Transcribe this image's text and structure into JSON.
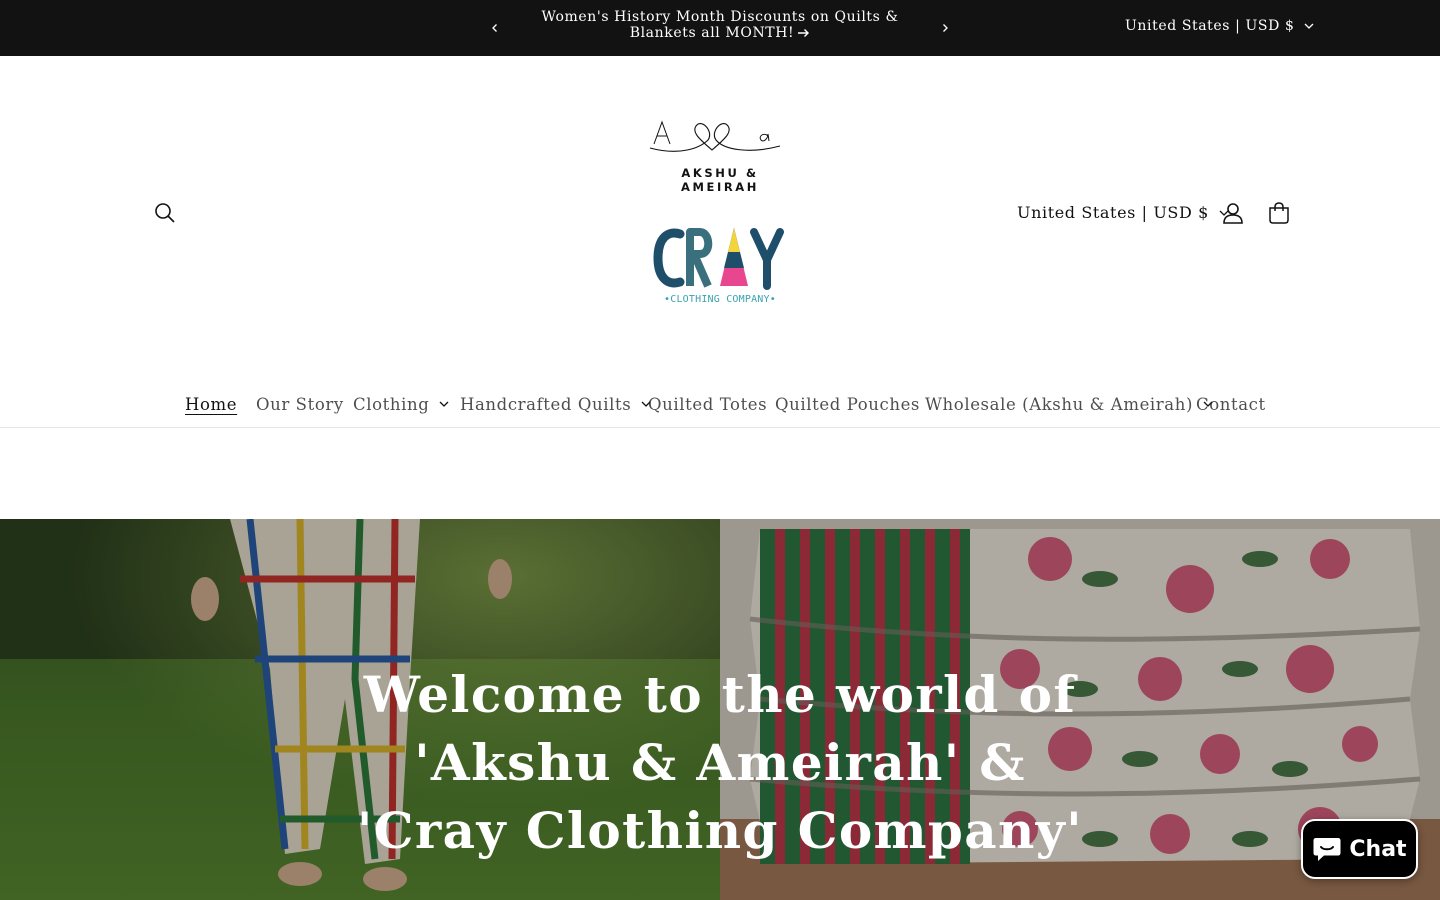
{
  "announcement": {
    "message": "Women's History Month Discounts on Quilts & Blankets all MONTH!",
    "locale": "United States | USD $"
  },
  "header": {
    "logo_primary": "AKSHU & AMEIRAH",
    "logo_secondary_name": "CRAY",
    "logo_secondary_sub": "•CLOTHING COMPANY•",
    "locale": "United States | USD $"
  },
  "nav": {
    "items": [
      {
        "label": "Home"
      },
      {
        "label": "Our Story"
      },
      {
        "label": "Clothing"
      },
      {
        "label": "Handcrafted Quilts"
      },
      {
        "label": "Quilted Totes"
      },
      {
        "label": "Quilted Pouches"
      },
      {
        "label": "Wholesale (Akshu & Ameirah)"
      },
      {
        "label": "Contact"
      }
    ]
  },
  "hero": {
    "title": "Welcome to the world of 'Akshu & Ameirah' & 'Cray Clothing Company'"
  },
  "chat": {
    "label": "Chat"
  },
  "colors": {
    "announcement_bg": "#121212",
    "text": "#121212",
    "chat_bg": "#000000",
    "cray_dark": "#1f4e6b",
    "cray_pink": "#e8468f",
    "cray_yellow": "#f2d43c",
    "cray_teal": "#3aa3b0"
  },
  "icons": [
    "chevron-left-icon",
    "chevron-right-icon",
    "arrow-right-icon",
    "chevron-down-icon",
    "search-icon",
    "account-icon",
    "cart-icon",
    "chat-bubble-icon"
  ]
}
